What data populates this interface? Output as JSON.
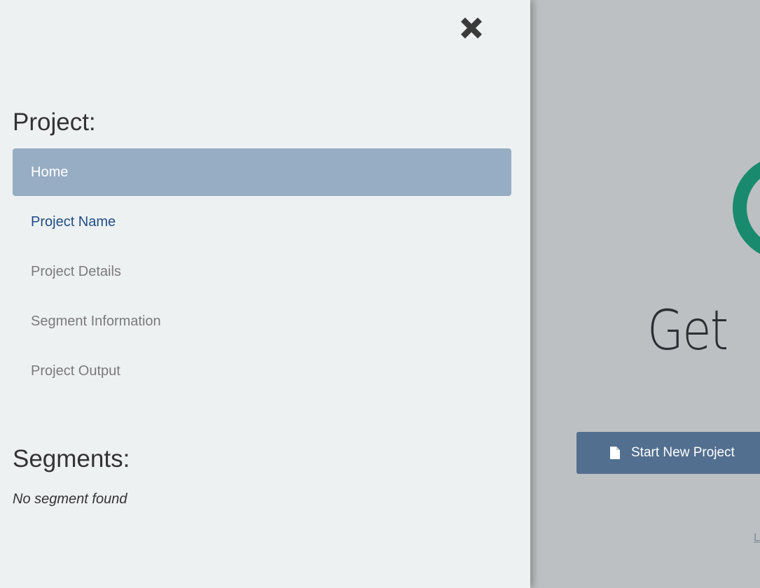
{
  "drawer": {
    "close_icon": "close-x-icon",
    "project_heading": "Project:",
    "nav_items": [
      {
        "label": "Home",
        "state": "active"
      },
      {
        "label": "Project Name",
        "state": "link"
      },
      {
        "label": "Project Details",
        "state": "disabled"
      },
      {
        "label": "Segment Information",
        "state": "disabled"
      },
      {
        "label": "Project Output",
        "state": "disabled"
      }
    ],
    "segments_heading": "Segments:",
    "segments_empty": "No segment found"
  },
  "main": {
    "logo_icon": "green-ring-logo-icon",
    "hero_heading": "Get",
    "start_button_icon": "file-icon",
    "start_button_label": "Start New Project",
    "link_text": "L"
  },
  "colors": {
    "drawer_bg": "#eef1f2",
    "active_item_bg": "#97adc4",
    "link_color": "#1f4d86",
    "button_bg": "#536f8f",
    "logo_green": "#1a8a6e",
    "overlay_bg": "#bdc0c2"
  }
}
